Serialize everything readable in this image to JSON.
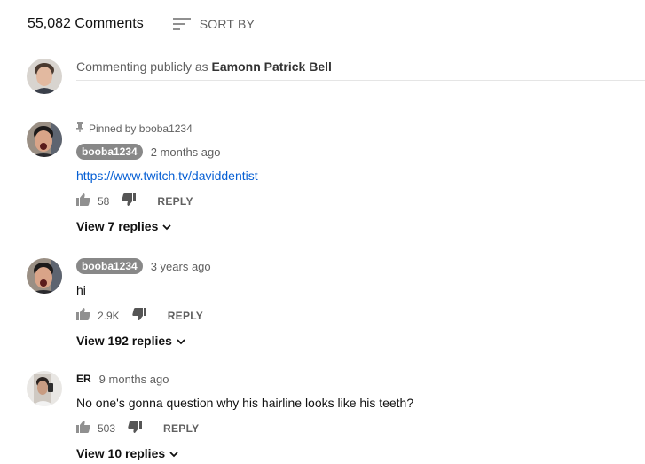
{
  "header": {
    "comment_count": "55,082 Comments",
    "sort_label": "SORT BY"
  },
  "compose": {
    "prefix": "Commenting publicly as ",
    "user": "Eamonn Patrick Bell"
  },
  "comments": [
    {
      "pinned_text": "Pinned by booba1234",
      "author": "booba1234",
      "time": "2 months ago",
      "text": "https://www.twitch.tv/daviddentist",
      "likes": "58",
      "reply_label": "REPLY",
      "view_replies": "View 7 replies"
    },
    {
      "author": "booba1234",
      "time": "3 years ago",
      "text": "hi",
      "likes": "2.9K",
      "reply_label": "REPLY",
      "view_replies": "View 192 replies"
    },
    {
      "author": "ER",
      "time": "9 months ago",
      "text": "No one's gonna question why his hairline looks like his teeth?",
      "likes": "503",
      "reply_label": "REPLY",
      "view_replies": "View 10 replies"
    }
  ],
  "icons": {
    "sort": "sort-icon",
    "pin": "pin-icon",
    "like": "thumbs-up-icon",
    "dislike": "thumbs-down-icon",
    "expand": "chevron-down-icon"
  },
  "colors": {
    "link": "#065fd4",
    "author_chip": "#888888",
    "secondary_text": "#606060"
  }
}
